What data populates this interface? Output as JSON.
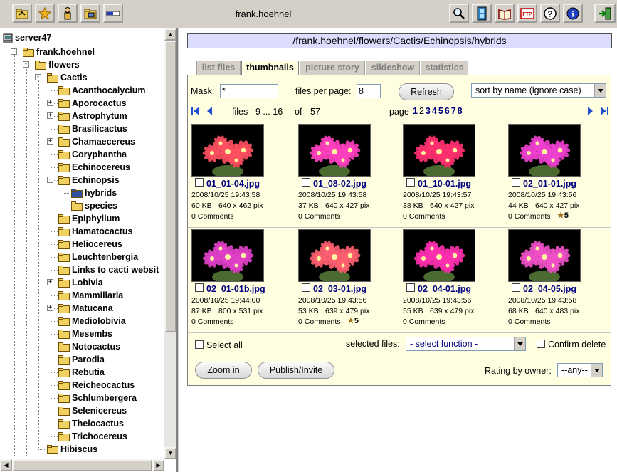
{
  "toolbar": {
    "user": "frank.hoehnel",
    "left_buttons": [
      "folder-up-icon",
      "favorites-star-icon",
      "user-icon",
      "folder-image-icon",
      "progress-bar-icon"
    ],
    "right_buttons": [
      "magnifier-icon",
      "film-icon",
      "book-icon",
      "ftp-icon",
      "help-icon",
      "info-icon",
      "exit-icon"
    ],
    "ftp_label": "FTP"
  },
  "tree": {
    "root": "server47",
    "user": "frank.hoehnel",
    "flowers": "flowers",
    "cactis": "Cactis",
    "items": [
      {
        "label": "Acanthocalycium",
        "exp": false
      },
      {
        "label": "Aporocactus",
        "exp": true
      },
      {
        "label": "Astrophytum",
        "exp": true
      },
      {
        "label": "Brasilicactus",
        "exp": false
      },
      {
        "label": "Chamaecereus",
        "exp": true
      },
      {
        "label": "Coryphantha",
        "exp": false
      },
      {
        "label": "Echinocereus",
        "exp": false
      },
      {
        "label": "Echinopsis",
        "exp": "open"
      },
      {
        "label": "hybrids",
        "sub": true,
        "selected": true
      },
      {
        "label": "species",
        "sub": true
      },
      {
        "label": "Epiphyllum",
        "exp": false
      },
      {
        "label": "Hamatocactus",
        "exp": false
      },
      {
        "label": "Heliocereus",
        "exp": false
      },
      {
        "label": "Leuchtenbergia",
        "exp": false
      },
      {
        "label": "Links to cacti websit",
        "exp": false
      },
      {
        "label": "Lobivia",
        "exp": true
      },
      {
        "label": "Mammillaria",
        "exp": false
      },
      {
        "label": "Matucana",
        "exp": true
      },
      {
        "label": "Mediolobivia",
        "exp": false
      },
      {
        "label": "Mesembs",
        "exp": false
      },
      {
        "label": "Notocactus",
        "exp": false
      },
      {
        "label": "Parodia",
        "exp": false
      },
      {
        "label": "Rebutia",
        "exp": false
      },
      {
        "label": "Reicheocactus",
        "exp": false
      },
      {
        "label": "Schlumbergera",
        "exp": false
      },
      {
        "label": "Selenicereus",
        "exp": false
      },
      {
        "label": "Thelocactus",
        "exp": false
      },
      {
        "label": "Trichocereus",
        "exp": false
      }
    ],
    "hibiscus": "Hibiscus"
  },
  "main": {
    "path": "/frank.hoehnel/flowers/Cactis/Echinopsis/hybrids",
    "tabs": [
      "list files",
      "thumbnails",
      "picture story",
      "slideshow",
      "statistics"
    ],
    "active_tab": "thumbnails",
    "mask_label": "Mask:",
    "mask_value": "*",
    "per_page_label": "files per page:",
    "per_page_value": "8",
    "refresh_label": "Refresh",
    "sort_value": "sort by name (ignore case)",
    "files_label": "files",
    "files_range": "9 ... 16",
    "of_label": "of",
    "total": "57",
    "page_label": "page",
    "pages": [
      "1",
      "2",
      "3",
      "4",
      "5",
      "6",
      "7",
      "8"
    ]
  },
  "thumbnails": [
    {
      "name": "01_01-04.jpg",
      "date": "2008/10/25 19:43:58",
      "size": "60 KB",
      "dims": "640 x 462 pix",
      "comments": "0 Comments",
      "rating": "",
      "color": "#ff5060"
    },
    {
      "name": "01_08-02.jpg",
      "date": "2008/10/25 19:43:58",
      "size": "37 KB",
      "dims": "640 x 427 pix",
      "comments": "0 Comments",
      "rating": "",
      "color": "#ff40c0"
    },
    {
      "name": "01_10-01.jpg",
      "date": "2008/10/25 19:43:57",
      "size": "38 KB",
      "dims": "640 x 427 pix",
      "comments": "0 Comments",
      "rating": "",
      "color": "#ff3070"
    },
    {
      "name": "02_01-01.jpg",
      "date": "2008/10/25 19:43:56",
      "size": "44 KB",
      "dims": "640 x 427 pix",
      "comments": "0 Comments",
      "rating": "5",
      "color": "#f040d0"
    },
    {
      "name": "02_01-01b.jpg",
      "date": "2008/10/25 19:44:00",
      "size": "87 KB",
      "dims": "800 x 531 pix",
      "comments": "0 Comments",
      "rating": "",
      "color": "#e040c8"
    },
    {
      "name": "02_03-01.jpg",
      "date": "2008/10/25 19:43:56",
      "size": "53 KB",
      "dims": "639 x 479 pix",
      "comments": "0 Comments",
      "rating": "5",
      "color": "#ff6070"
    },
    {
      "name": "02_04-01.jpg",
      "date": "2008/10/25 19:43:56",
      "size": "55 KB",
      "dims": "639 x 479 pix",
      "comments": "0 Comments",
      "rating": "",
      "color": "#ff30b0"
    },
    {
      "name": "02_04-05.jpg",
      "date": "2008/10/25 19:43:58",
      "size": "68 KB",
      "dims": "640 x 483 pix",
      "comments": "0 Comments",
      "rating": "",
      "color": "#f050c8"
    }
  ],
  "footer": {
    "select_all": "Select all",
    "selected_files_label": "selected files:",
    "select_function": "- select function -",
    "confirm_delete": "Confirm delete",
    "zoom_in": "Zoom in",
    "publish": "Publish/Invite",
    "rating_label": "Rating by owner:",
    "rating_value": "--any--"
  }
}
